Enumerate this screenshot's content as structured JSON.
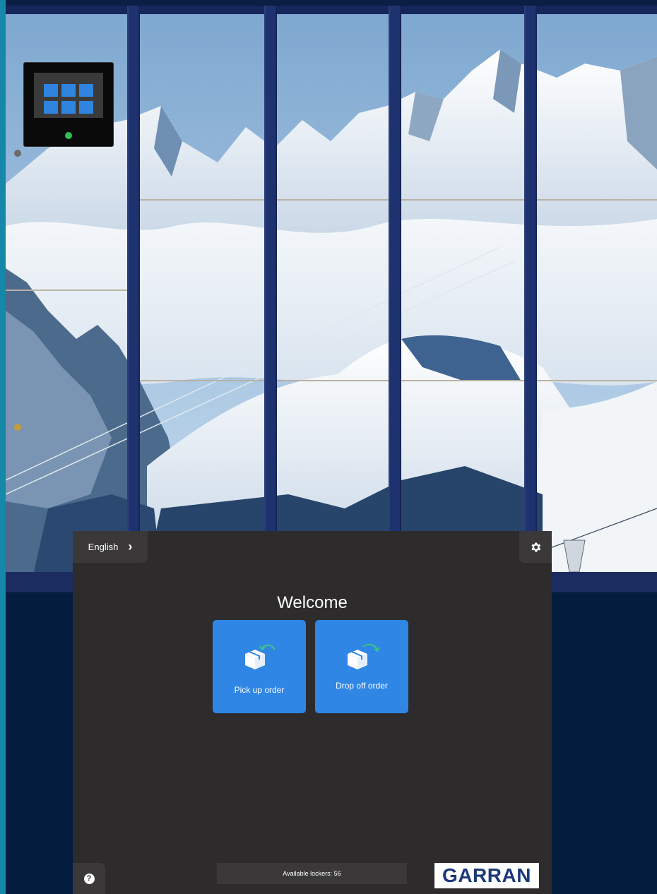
{
  "kiosk": {
    "language_label": "English",
    "welcome_title": "Welcome",
    "actions": [
      {
        "label": "Pick up order",
        "icon": "package-return-icon"
      },
      {
        "label": "Drop off order",
        "icon": "package-send-icon"
      }
    ],
    "status_text": "Available lockers: 56",
    "brand_logo_text": "GARRAN",
    "help_label": "?"
  },
  "icons": {
    "language_chevron": "chevron-right-icon",
    "settings": "gear-icon",
    "help": "question-circle-icon"
  },
  "colors": {
    "panel_background": "#2d2b2b",
    "panel_button": "#3a3838",
    "action_blue": "#2f86e5",
    "arrow_green": "#3ec28a",
    "page_background": "#041c3e",
    "brand_blue": "#1c3a7a"
  }
}
